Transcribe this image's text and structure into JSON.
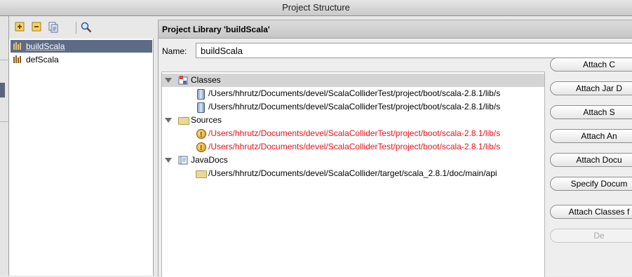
{
  "window": {
    "title": "Project Structure"
  },
  "toolbar": {
    "add_icon": "add-icon",
    "remove_icon": "remove-icon",
    "copy_icon": "copy-icon",
    "find_icon": "find-icon"
  },
  "libraries": [
    {
      "label": "buildScala",
      "selected": true
    },
    {
      "label": "defScala",
      "selected": false
    }
  ],
  "panel": {
    "title": "Project Library 'buildScala'",
    "name_label": "Name:",
    "name_value": "buildScala"
  },
  "roots": {
    "classes": {
      "label": "Classes",
      "items": [
        "/Users/hhrutz/Documents/devel/ScalaColliderTest/project/boot/scala-2.8.1/lib/s",
        "/Users/hhrutz/Documents/devel/ScalaColliderTest/project/boot/scala-2.8.1/lib/s"
      ]
    },
    "sources": {
      "label": "Sources",
      "items": [
        "/Users/hhrutz/Documents/devel/ScalaColliderTest/project/boot/scala-2.8.1/lib/s",
        "/Users/hhrutz/Documents/devel/ScalaColliderTest/project/boot/scala-2.8.1/lib/s"
      ]
    },
    "javadocs": {
      "label": "JavaDocs",
      "items": [
        "/Users/hhrutz/Documents/devel/ScalaCollider/target/scala_2.8.1/doc/main/api"
      ]
    }
  },
  "buttons": {
    "attach_classes": "Attach C",
    "attach_jar": "Attach Jar D",
    "attach_sources": "Attach S",
    "attach_annotations": "Attach An",
    "attach_documentation": "Attach Docu",
    "specify_documentation": "Specify Docum",
    "attach_classes_from": "Attach Classes f",
    "detach": "De"
  },
  "colors": {
    "selection": "#5d6b86",
    "missing_path": "#e8121a",
    "header_bg": "#d2d2d2"
  }
}
